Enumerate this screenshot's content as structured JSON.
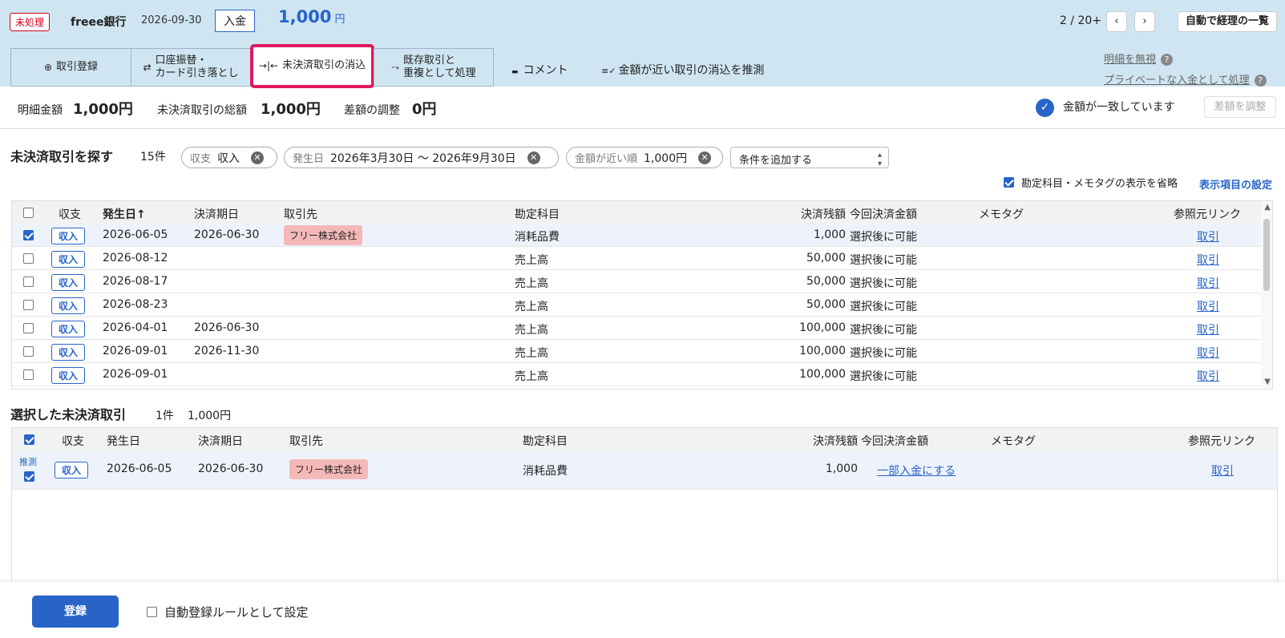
{
  "header": {
    "status_badge": "未処理",
    "bank": "freee銀行",
    "date": "2026-09-30",
    "type": "入金",
    "amount": "1,000",
    "amount_unit": "円",
    "pager": "2 / 20+",
    "prev_icon": "‹",
    "next_icon": "›",
    "list_button": "自動で経理の一覧"
  },
  "tabs": [
    {
      "icon": "⊕",
      "label": "取引登録"
    },
    {
      "icon": "⇄",
      "label1": "口座振替・",
      "label2": "カード引き落とし"
    },
    {
      "icon": "→|←",
      "label": "未決済取引の消込"
    },
    {
      "icon": "⤳",
      "label1": "既存取引と",
      "label2": "重複として処理"
    }
  ],
  "tab_links": {
    "comment": "コメント",
    "comment_icon": "▬",
    "suggest": "金額が近い取引の消込を推測",
    "suggest_icon": "≡✓"
  },
  "right_links": {
    "ignore": "明細を無視",
    "private": "プライベートな入金として処理",
    "help": "?"
  },
  "summary": {
    "detail_label": "明細金額",
    "detail_value": "1,000円",
    "total_label": "未決済取引の総額",
    "total_value": "1,000円",
    "adjust_label": "差額の調整",
    "adjust_value": "0円",
    "match_text": "金額が一致しています",
    "check_icon": "✓",
    "adjust_button": "差額を調整"
  },
  "search": {
    "title": "未決済取引を探す",
    "count": "15件",
    "chips": [
      {
        "key": "収支",
        "value": "収入"
      },
      {
        "key": "発生日",
        "value": "2026年3月30日 〜 2026年9月30日"
      },
      {
        "key": "金額が近い順",
        "value": "1,000円"
      }
    ],
    "chip_clear": "✕",
    "add_condition": "条件を追加する",
    "omit_label": "勘定科目・メモタグの表示を省略",
    "settings_link": "表示項目の設定"
  },
  "columns": {
    "type": "収支",
    "date": "発生日",
    "sort_icon": "↑",
    "due": "決済期日",
    "partner": "取引先",
    "account": "勘定科目",
    "balance": "決済残額",
    "this_amount": "今回決済金額",
    "memo": "メモタグ",
    "ref": "参照元リンク"
  },
  "rows": [
    {
      "checked": true,
      "type": "収入",
      "date": "2026-06-05",
      "due": "2026-06-30",
      "partner": "フリー株式会社",
      "account": "消耗品費",
      "balance": "1,000",
      "this_amount": "選択後に可能",
      "ref": "取引"
    },
    {
      "checked": false,
      "type": "収入",
      "date": "2026-08-12",
      "due": "",
      "partner": "",
      "account": "売上高",
      "balance": "50,000",
      "this_amount": "選択後に可能",
      "ref": "取引"
    },
    {
      "checked": false,
      "type": "収入",
      "date": "2026-08-17",
      "due": "",
      "partner": "",
      "account": "売上高",
      "balance": "50,000",
      "this_amount": "選択後に可能",
      "ref": "取引"
    },
    {
      "checked": false,
      "type": "収入",
      "date": "2026-08-23",
      "due": "",
      "partner": "",
      "account": "売上高",
      "balance": "50,000",
      "this_amount": "選択後に可能",
      "ref": "取引"
    },
    {
      "checked": false,
      "type": "収入",
      "date": "2026-04-01",
      "due": "2026-06-30",
      "partner": "",
      "account": "売上高",
      "balance": "100,000",
      "this_amount": "選択後に可能",
      "ref": "取引"
    },
    {
      "checked": false,
      "type": "収入",
      "date": "2026-09-01",
      "due": "2026-11-30",
      "partner": "",
      "account": "売上高",
      "balance": "100,000",
      "this_amount": "選択後に可能",
      "ref": "取引"
    },
    {
      "checked": false,
      "type": "収入",
      "date": "2026-09-01",
      "due": "",
      "partner": "",
      "account": "売上高",
      "balance": "100,000",
      "this_amount": "選択後に可能",
      "ref": "取引"
    }
  ],
  "scroll": {
    "up": "▲",
    "down": "▼"
  },
  "selected": {
    "title": "選択した未決済取引",
    "count": "1件",
    "total": "1,000円",
    "rows": [
      {
        "tag": "推測",
        "checked": true,
        "type": "収入",
        "date": "2026-06-05",
        "due": "2026-06-30",
        "partner": "フリー株式会社",
        "account": "消耗品費",
        "balance": "1,000",
        "this_amount": "一部入金にする",
        "ref": "取引"
      }
    ]
  },
  "footer": {
    "register": "登録",
    "auto_rule": "自動登録ルールとして設定"
  },
  "colors": {
    "accent": "#2864c8",
    "header_bg": "#cfe6f2",
    "active_tab_border": "#e0195f",
    "status_red": "#d0021b",
    "vendor_bg": "#f5b8b8"
  }
}
